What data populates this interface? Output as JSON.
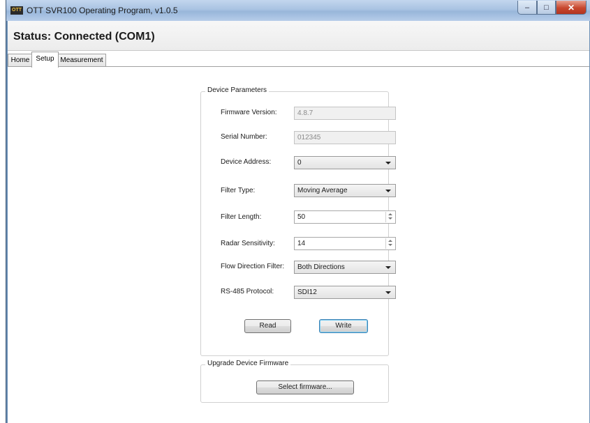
{
  "window": {
    "icon_label": "OTT",
    "title": "OTT SVR100 Operating Program, v1.0.5",
    "minimize_glyph": "–",
    "maximize_glyph": "□",
    "close_glyph": "✕"
  },
  "status": {
    "text": "Status: Connected (COM1)"
  },
  "tabs": [
    {
      "label": "Home",
      "active": false
    },
    {
      "label": "Setup",
      "active": true
    },
    {
      "label": "Measurement",
      "active": false
    }
  ],
  "device_parameters": {
    "title": "Device Parameters",
    "firmware_version": {
      "label": "Firmware Version:",
      "value": "4.8.7"
    },
    "serial_number": {
      "label": "Serial Number:",
      "value": "012345"
    },
    "device_address": {
      "label": "Device Address:",
      "value": "0"
    },
    "filter_type": {
      "label": "Filter Type:",
      "value": "Moving Average"
    },
    "filter_length": {
      "label": "Filter Length:",
      "value": "50"
    },
    "radar_sensitivity": {
      "label": "Radar Sensitivity:",
      "value": "14"
    },
    "flow_direction_filter": {
      "label": "Flow Direction Filter:",
      "value": "Both Directions"
    },
    "rs485_protocol": {
      "label": "RS-485 Protocol:",
      "value": "SDI12"
    },
    "read_button": "Read",
    "write_button": "Write"
  },
  "upgrade_firmware": {
    "title": "Upgrade Device Firmware",
    "select_button": "Select firmware..."
  },
  "colors": {
    "titlebar": "#a9c3e2",
    "close_button": "#c7472e",
    "default_button_border": "#3c7fb1"
  }
}
